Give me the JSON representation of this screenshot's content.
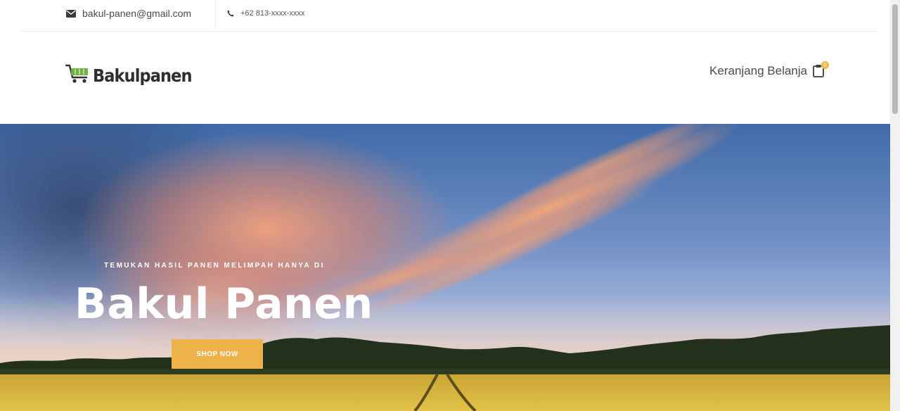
{
  "topbar": {
    "email": "bakul-panen@gmail.com",
    "phone": "+62 813-xxxx-xxxx",
    "email_icon": "envelope-icon",
    "phone_icon": "phone-icon"
  },
  "header": {
    "logo_text": "Bakulpanen",
    "logo_icon": "shopping-cart-icon",
    "cart_label": "Keranjang Belanja",
    "cart_icon": "clipboard-icon",
    "cart_count": "0"
  },
  "hero": {
    "subtitle": "TEMUKAN HASIL PANEN MELIMPAH HANYA DI",
    "title": "Bakul Panen",
    "button_label": "SHOP NOW"
  },
  "colors": {
    "accent": "#edb24a",
    "text_dark": "#2e2e2e",
    "logo_green": "#6db33f"
  }
}
